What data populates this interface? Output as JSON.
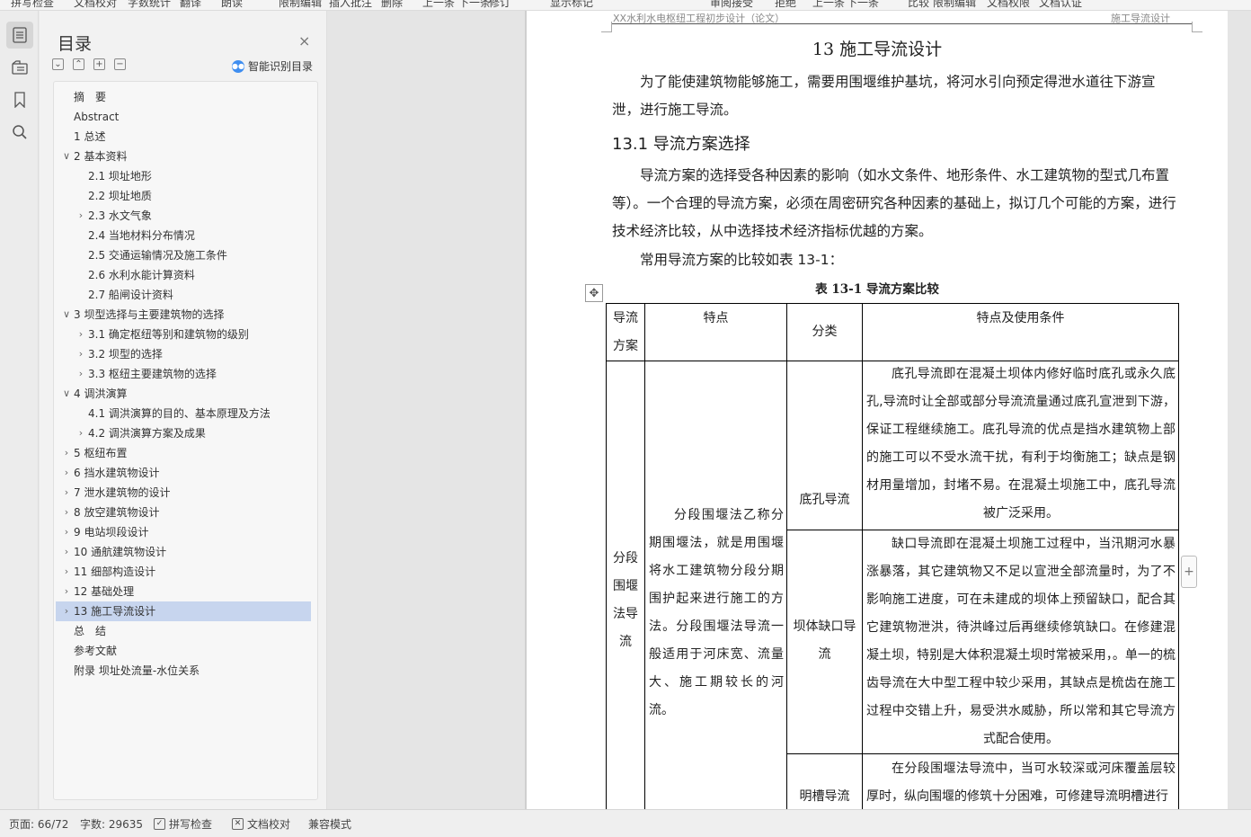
{
  "toolbar": {
    "items": [
      "拼写检查",
      "文档校对",
      "字数统计",
      "翻译",
      "朗读",
      "限制编辑",
      "插入批注",
      "删除",
      "上一条",
      "下一条",
      "修订",
      "显示标记",
      "审阅",
      "接受",
      "拒绝",
      "上一条",
      "下一条",
      "比较",
      "限制编辑",
      "文档权限",
      "文档认证"
    ]
  },
  "rail": {
    "icons": [
      "toc-icon",
      "navigation-icon",
      "bookmark-icon",
      "search-icon"
    ]
  },
  "toc": {
    "title": "目录",
    "close": "×",
    "tools": [
      "⌄",
      "⌃",
      "+",
      "−"
    ],
    "ai_label": "智能识别目录",
    "items": [
      {
        "label": "摘　要",
        "level": 1,
        "chevron": ""
      },
      {
        "label": "Abstract",
        "level": 1,
        "chevron": ""
      },
      {
        "label": "1 总述",
        "level": 1,
        "chevron": ""
      },
      {
        "label": "2 基本资料",
        "level": 1,
        "chevron": "∨"
      },
      {
        "label": "2.1  坝址地形",
        "level": 2,
        "chevron": ""
      },
      {
        "label": "2.2  坝址地质",
        "level": 2,
        "chevron": ""
      },
      {
        "label": "2.3  水文气象",
        "level": 2,
        "chevron": "›"
      },
      {
        "label": "2.4  当地材料分布情况",
        "level": 2,
        "chevron": ""
      },
      {
        "label": "2.5  交通运输情况及施工条件",
        "level": 2,
        "chevron": ""
      },
      {
        "label": "2.6  水利水能计算资料",
        "level": 2,
        "chevron": ""
      },
      {
        "label": "2.7  船闸设计资料",
        "level": 2,
        "chevron": ""
      },
      {
        "label": "3 坝型选择与主要建筑物的选择",
        "level": 1,
        "chevron": "∨"
      },
      {
        "label": "3.1  确定枢纽等别和建筑物的级别",
        "level": 2,
        "chevron": "›"
      },
      {
        "label": "3.2  坝型的选择",
        "level": 2,
        "chevron": "›"
      },
      {
        "label": "3.3  枢纽主要建筑物的选择",
        "level": 2,
        "chevron": "›"
      },
      {
        "label": "4 调洪演算",
        "level": 1,
        "chevron": "∨"
      },
      {
        "label": "4.1 调洪演算的目的、基本原理及方法",
        "level": 2,
        "chevron": ""
      },
      {
        "label": "4.2  调洪演算方案及成果",
        "level": 2,
        "chevron": "›"
      },
      {
        "label": "5 枢纽布置",
        "level": 1,
        "chevron": "›"
      },
      {
        "label": "6 挡水建筑物设计",
        "level": 1,
        "chevron": "›"
      },
      {
        "label": "7 泄水建筑物的设计",
        "level": 1,
        "chevron": "›"
      },
      {
        "label": "8 放空建筑物设计",
        "level": 1,
        "chevron": "›"
      },
      {
        "label": "9 电站坝段设计",
        "level": 1,
        "chevron": "›"
      },
      {
        "label": "10 通航建筑物设计",
        "level": 1,
        "chevron": "›"
      },
      {
        "label": "11 细部构造设计",
        "level": 1,
        "chevron": "›"
      },
      {
        "label": "12 基础处理",
        "level": 1,
        "chevron": "›"
      },
      {
        "label": "13 施工导流设计",
        "level": 1,
        "chevron": "›",
        "selected": true
      },
      {
        "label": "总　结",
        "level": 1,
        "chevron": ""
      },
      {
        "label": "参考文献",
        "level": 1,
        "chevron": ""
      },
      {
        "label": "附录  坝址处流量-水位关系",
        "level": 1,
        "chevron": ""
      }
    ]
  },
  "document": {
    "header_left": "XX水利水电枢纽工程初步设计（论文）",
    "header_right": "施工导流设计",
    "chapter_title": "13 施工导流设计",
    "intro": "为了能使建筑物能够施工，需要用围堰维护基坑，将河水引向预定得泄水道往下游宣泄，进行施工导流。",
    "section_title": "13.1 导流方案选择",
    "section_para": "导流方案的选择受各种因素的影响（如水文条件、地形条件、水工建筑物的型式几布置等）。一个合理的导流方案，必须在周密研究各种因素的基础上，拟订几个可能的方案，进行技术经济比较，从中选择技术经济指标优越的方案。",
    "table_intro": "常用导流方案的比较如表 13-1：",
    "table_caption": "表 13-1  导流方案比较",
    "table": {
      "headers": [
        "导流方案",
        "特点",
        "分类",
        "特点及使用条件"
      ],
      "scheme": "分段围堰法导流",
      "feature": "分段围堰法乙称分期围堰法，就是用围堰将水工建筑物分段分期围护起来进行施工的方法。分段围堰法导流一般适用于河床宽、流量大、施工期较长的河流。",
      "rows": [
        {
          "type": "底孔导流",
          "desc": "底孔导流即在混凝土坝体内修好临时底孔或永久底孔,导流时让全部或部分导流流量通过底孔宣泄到下游，保证工程继续施工。底孔导流的优点是挡水建筑物上部的施工可以不受水流干扰，有利于均衡施工；缺点是钢材用量增加，封堵不易。在混凝土坝施工中，底孔导流被广泛采用。"
        },
        {
          "type": "坝体缺口导流",
          "desc": "缺口导流即在混凝土坝施工过程中，当汛期河水暴涨暴落，其它建筑物又不足以宣泄全部流量时，为了不影响施工进度，可在未建成的坝体上预留缺口，配合其它建筑物泄洪，待洪峰过后再继续修筑缺口。在修建混凝土坝，特别是大体积混凝土坝时常被采用，。单一的梳齿导流在大中型工程中较少采用，其缺点是梳齿在施工过程中交错上升，易受洪水威胁，所以常和其它导流方式配合使用。"
        },
        {
          "type": "明槽导流",
          "desc": "在分段围堰法导流中，当可水较深或河床覆盖层较厚时，纵向围堰的修筑十分困难，可修建导流明槽进行"
        }
      ]
    }
  },
  "statusbar": {
    "page": "页面: 66/72",
    "words": "字数: 29635",
    "spell": "拼写检查",
    "proof": "文档校对",
    "compat": "兼容模式"
  }
}
